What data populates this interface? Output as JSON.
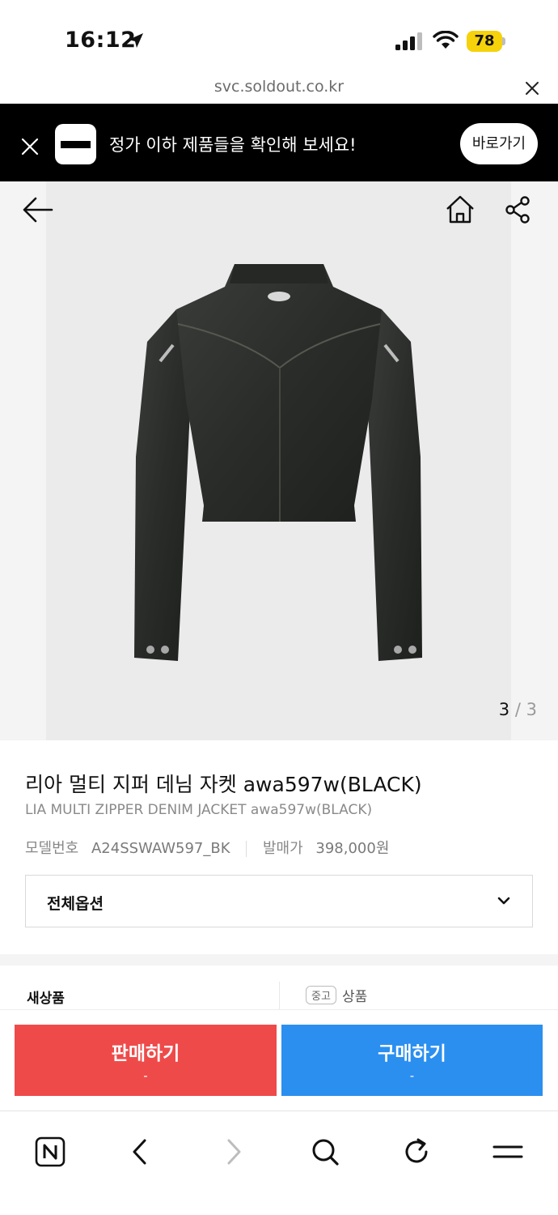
{
  "status_bar": {
    "time": "16:12",
    "battery": "78"
  },
  "browser": {
    "url": "svc.soldout.co.kr"
  },
  "banner": {
    "text": "정가 이하 제품들을 확인해 보세요!",
    "button_label": "바로가기"
  },
  "gallery": {
    "current": "3",
    "separator": "/",
    "total": "3"
  },
  "product": {
    "title": "리아 멀티 지퍼 데님 자켓 awa597w(BLACK)",
    "subtitle": "LIA MULTI ZIPPER DENIM JACKET awa597w(BLACK)",
    "model_label": "모델번호",
    "model_value": "A24SSWAW597_BK",
    "release_label": "발매가",
    "release_value": "398,000원"
  },
  "option": {
    "label": "전체옵션"
  },
  "tabs": {
    "new_label": "새상품",
    "used_badge": "중고",
    "used_label": "상품"
  },
  "actions": {
    "sell_label": "판매하기",
    "sell_price": "-",
    "buy_label": "구매하기",
    "buy_price": "-"
  },
  "colors": {
    "sell": "#ef4a4a",
    "buy": "#2b8ff0",
    "banner_bg": "#000000",
    "battery": "#f5d20a"
  },
  "icons": {
    "status": [
      "location-arrow-icon",
      "signal-icon",
      "wifi-icon",
      "battery-icon"
    ],
    "nav": [
      "back-arrow-icon",
      "home-icon",
      "share-icon"
    ],
    "browser_toolbar": [
      "naver-n-icon",
      "back-icon",
      "forward-icon",
      "search-icon",
      "refresh-icon",
      "menu-icon"
    ]
  }
}
